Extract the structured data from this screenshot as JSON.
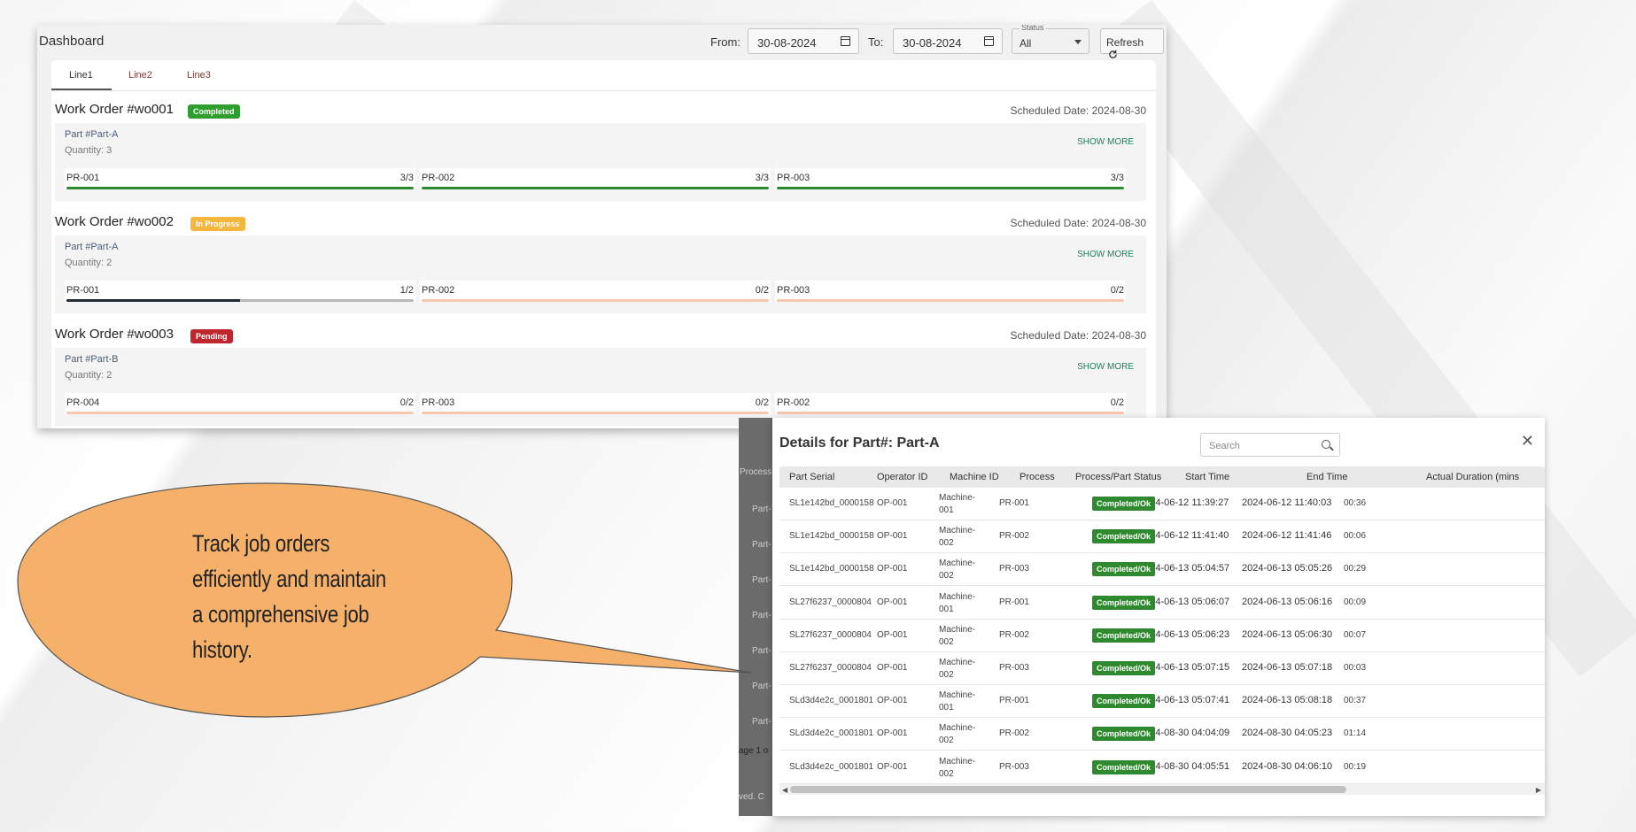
{
  "dashboard": {
    "title": "Dashboard",
    "from_label": "From:",
    "from_value": "30-08-2024",
    "to_label": "To:",
    "to_value": "30-08-2024",
    "status_label": "Status",
    "status_value": "All",
    "refresh_label": "Refresh",
    "tabs": [
      "Line1",
      "Line2",
      "Line3"
    ],
    "scheduled_label": "Scheduled Date:",
    "show_more": "SHOW MORE",
    "work_orders": [
      {
        "title": "Work Order #wo001",
        "status": "Completed",
        "status_color": "#2e9e2e",
        "date": "2024-08-30",
        "part": "Part #Part-A",
        "quantity": "Quantity: 3",
        "processes": [
          {
            "id": "PR-001",
            "count": "3/3",
            "done": 3,
            "total": 3
          },
          {
            "id": "PR-002",
            "count": "3/3",
            "done": 3,
            "total": 3
          },
          {
            "id": "PR-003",
            "count": "3/3",
            "done": 3,
            "total": 3
          }
        ]
      },
      {
        "title": "Work Order #wo002",
        "status": "In Progress",
        "status_color": "#f5b63d",
        "date": "2024-08-30",
        "part": "Part #Part-A",
        "quantity": "Quantity: 2",
        "processes": [
          {
            "id": "PR-001",
            "count": "1/2",
            "done": 1,
            "total": 2
          },
          {
            "id": "PR-002",
            "count": "0/2",
            "done": 0,
            "total": 2
          },
          {
            "id": "PR-003",
            "count": "0/2",
            "done": 0,
            "total": 2
          }
        ]
      },
      {
        "title": "Work Order #wo003",
        "status": "Pending",
        "status_color": "#c0262d",
        "date": "2024-08-30",
        "part": "Part #Part-B",
        "quantity": "Quantity: 2",
        "processes": [
          {
            "id": "PR-004",
            "count": "0/2",
            "done": 0,
            "total": 2
          },
          {
            "id": "PR-003",
            "count": "0/2",
            "done": 0,
            "total": 2
          },
          {
            "id": "PR-002",
            "count": "0/2",
            "done": 0,
            "total": 2
          }
        ]
      }
    ]
  },
  "callout": {
    "text": "Track job orders efficiently and maintain a comprehensive job history.",
    "fill_color": "#f5b06a"
  },
  "background_page": {
    "fragments": [
      "Process",
      "Part-",
      "Part-",
      "Part-",
      "Part-",
      "Part-",
      "Part-",
      "Part-",
      "age 1 o",
      "ved. C"
    ]
  },
  "modal": {
    "title": "Details for Part#: Part-A",
    "search_placeholder": "Search",
    "close_icon": "close-icon",
    "columns": [
      "Part Serial",
      "Operator ID",
      "Machine ID",
      "Process",
      "Process/Part Status",
      "Start Time",
      "End Time",
      "Actual Duration (mins"
    ],
    "rows": [
      {
        "serial": "SL1e142bd_0000158",
        "operator": "OP-001",
        "machine": "Machine-001",
        "process": "PR-001",
        "status": "Completed/Ok",
        "start": "2024-06-12 11:39:27",
        "end": "2024-06-12 11:40:03",
        "duration": "00:36"
      },
      {
        "serial": "SL1e142bd_0000158",
        "operator": "OP-001",
        "machine": "Machine-002",
        "process": "PR-002",
        "status": "Completed/Ok",
        "start": "2024-06-12 11:41:40",
        "end": "2024-06-12 11:41:46",
        "duration": "00:06"
      },
      {
        "serial": "SL1e142bd_0000158",
        "operator": "OP-001",
        "machine": "Machine-002",
        "process": "PR-003",
        "status": "Completed/Ok",
        "start": "2024-06-13 05:04:57",
        "end": "2024-06-13 05:05:26",
        "duration": "00:29"
      },
      {
        "serial": "SL27f6237_0000804",
        "operator": "OP-001",
        "machine": "Machine-001",
        "process": "PR-001",
        "status": "Completed/Ok",
        "start": "2024-06-13 05:06:07",
        "end": "2024-06-13 05:06:16",
        "duration": "00:09"
      },
      {
        "serial": "SL27f6237_0000804",
        "operator": "OP-001",
        "machine": "Machine-002",
        "process": "PR-002",
        "status": "Completed/Ok",
        "start": "2024-06-13 05:06:23",
        "end": "2024-06-13 05:06:30",
        "duration": "00:07"
      },
      {
        "serial": "SL27f6237_0000804",
        "operator": "OP-001",
        "machine": "Machine-002",
        "process": "PR-003",
        "status": "Completed/Ok",
        "start": "2024-06-13 05:07:15",
        "end": "2024-06-13 05:07:18",
        "duration": "00:03"
      },
      {
        "serial": "SLd3d4e2c_0001801",
        "operator": "OP-001",
        "machine": "Machine-001",
        "process": "PR-001",
        "status": "Completed/Ok",
        "start": "2024-06-13 05:07:41",
        "end": "2024-06-13 05:08:18",
        "duration": "00:37"
      },
      {
        "serial": "SLd3d4e2c_0001801",
        "operator": "OP-001",
        "machine": "Machine-002",
        "process": "PR-002",
        "status": "Completed/Ok",
        "start": "2024-08-30 04:04:09",
        "end": "2024-08-30 04:05:23",
        "duration": "01:14"
      },
      {
        "serial": "SLd3d4e2c_0001801",
        "operator": "OP-001",
        "machine": "Machine-002",
        "process": "PR-003",
        "status": "Completed/Ok",
        "start": "2024-08-30 04:05:51",
        "end": "2024-08-30 04:06:10",
        "duration": "00:19"
      }
    ]
  }
}
